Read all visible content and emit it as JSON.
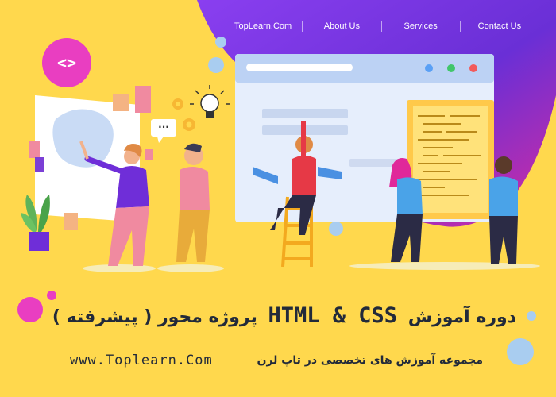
{
  "nav": {
    "items": [
      {
        "label": "TopLearn.Com"
      },
      {
        "label": "About Us"
      },
      {
        "label": "Services"
      },
      {
        "label": "Contact Us"
      }
    ]
  },
  "badge": {
    "code_symbol": "<>"
  },
  "speech_bubble": {
    "text": "..."
  },
  "caption": {
    "title_prefix": "دوره آموزش",
    "title_en": "HTML & CSS",
    "title_suffix": "پروژه محور ( پیشرفته )",
    "subtitle": "مجموعه آموزش های تخصصی در تاپ لرن",
    "website": "www.Toplearn.Com"
  },
  "colors": {
    "background": "#ffd84d",
    "purple": "#6f2ed8",
    "magenta": "#e0289a",
    "dark_text": "#222a3a",
    "light_blue": "#a9cdf0"
  }
}
